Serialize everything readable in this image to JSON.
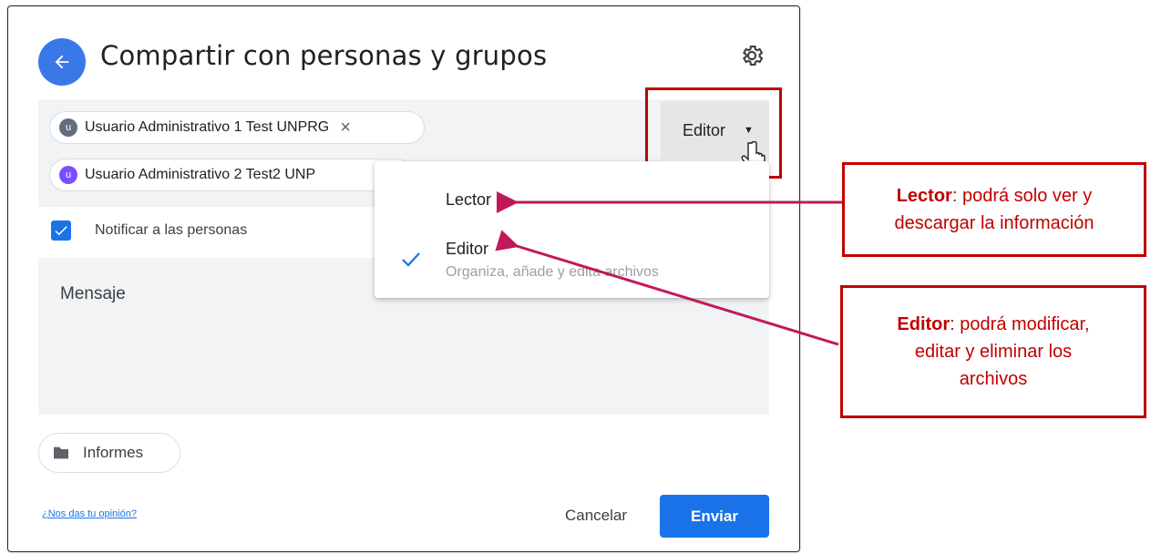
{
  "dialog": {
    "title": "Compartir con personas y grupos"
  },
  "recipients": [
    {
      "initial": "u",
      "name": "Usuario Administrativo 1 Test UNPRG",
      "avatar_color": "#5f6f7f"
    },
    {
      "initial": "u",
      "name": "Usuario Administrativo 2 Test2 UNP",
      "avatar_color": "#7c4dff"
    }
  ],
  "role_selector": {
    "label": "Editor"
  },
  "role_menu": {
    "items": [
      {
        "label": "Lector",
        "description": ""
      },
      {
        "label": "Editor",
        "description": "Organiza, añade y edita archivos",
        "selected": true
      }
    ]
  },
  "notify": {
    "label": "Notificar a las personas",
    "checked": true
  },
  "message": {
    "placeholder": "Mensaje"
  },
  "folder": {
    "label": "Informes"
  },
  "footer": {
    "feedback_link": "¿Nos das tu opinión?",
    "cancel_label": "Cancelar",
    "send_label": "Enviar"
  },
  "annotations": {
    "lector": {
      "strong": "Lector",
      "rest_line1": ": podrá solo ver y",
      "line2": "descargar la información"
    },
    "editor": {
      "strong": "Editor",
      "rest_line1": ": podrá modificar,",
      "line2": "editar y eliminar los",
      "line3": "archivos"
    }
  },
  "colors": {
    "accent_blue": "#1a73e8",
    "annotation_red": "#c00000",
    "arrow_pink": "#c2185b"
  }
}
